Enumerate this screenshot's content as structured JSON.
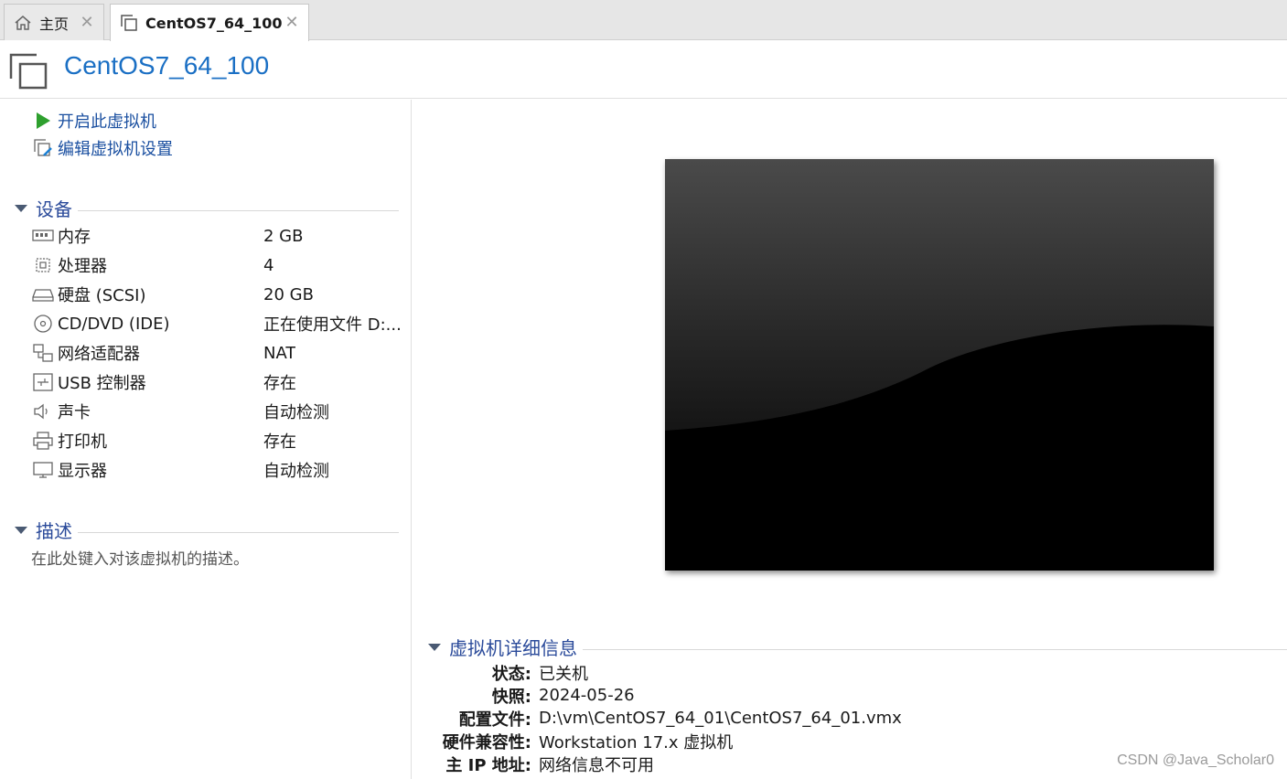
{
  "tabs": [
    {
      "label": "主页",
      "icon": "home-icon"
    },
    {
      "label": "CentOS7_64_100",
      "icon": "vm-icon"
    }
  ],
  "header": {
    "title": "CentOS7_64_100"
  },
  "actions": [
    {
      "label": "开启此虚拟机",
      "icon": "play-icon"
    },
    {
      "label": "编辑虚拟机设置",
      "icon": "edit-settings-icon"
    }
  ],
  "devices": {
    "title": "设备",
    "items": [
      {
        "name": "内存",
        "value": "2 GB",
        "icon": "memory-icon"
      },
      {
        "name": "处理器",
        "value": "4",
        "icon": "cpu-icon"
      },
      {
        "name": "硬盘 (SCSI)",
        "value": "20 GB",
        "icon": "harddisk-icon"
      },
      {
        "name": "CD/DVD (IDE)",
        "value": "正在使用文件 D:...",
        "icon": "cd-icon"
      },
      {
        "name": "网络适配器",
        "value": "NAT",
        "icon": "network-icon"
      },
      {
        "name": "USB 控制器",
        "value": "存在",
        "icon": "usb-icon"
      },
      {
        "name": "声卡",
        "value": "自动检测",
        "icon": "speaker-icon"
      },
      {
        "name": "打印机",
        "value": "存在",
        "icon": "printer-icon"
      },
      {
        "name": "显示器",
        "value": "自动检测",
        "icon": "monitor-icon"
      }
    ]
  },
  "description": {
    "title": "描述",
    "placeholder": "在此处键入对该虚拟机的描述。"
  },
  "details": {
    "title": "虚拟机详细信息",
    "rows": [
      {
        "key": "状态:",
        "value": "已关机"
      },
      {
        "key": "快照:",
        "value": "2024-05-26"
      },
      {
        "key": "配置文件:",
        "value": "D:\\vm\\CentOS7_64_01\\CentOS7_64_01.vmx"
      },
      {
        "key": "硬件兼容性:",
        "value": "Workstation 17.x 虚拟机"
      },
      {
        "key": "主 IP 地址:",
        "value": "网络信息不可用"
      }
    ]
  },
  "watermark": "CSDN @Java_Scholar0",
  "colors": {
    "accent": "#1a6fc4",
    "section": "#2a4a9a",
    "play": "#2ea02e"
  }
}
